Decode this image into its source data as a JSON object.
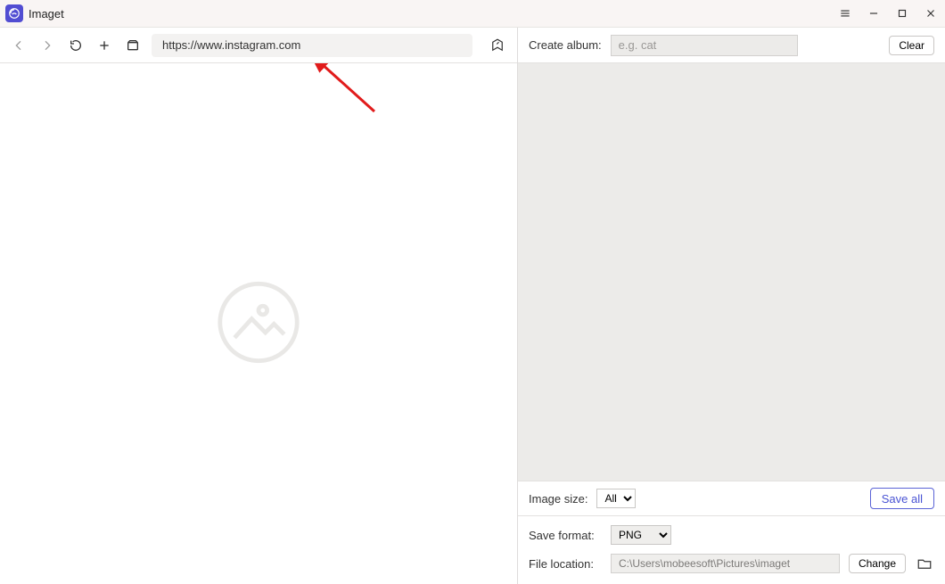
{
  "titlebar": {
    "app_name": "Imaget"
  },
  "left": {
    "url_value": "https://www.instagram.com"
  },
  "right": {
    "create_album_label": "Create album:",
    "create_album_placeholder": "e.g. cat",
    "clear_label": "Clear",
    "image_size_label": "Image size:",
    "image_size_value": "All",
    "save_all_label": "Save all",
    "save_format_label": "Save format:",
    "save_format_value": "PNG",
    "file_location_label": "File location:",
    "file_location_value": "C:\\Users\\mobeesoft\\Pictures\\imaget",
    "change_label": "Change"
  },
  "annotation": {
    "color": "#e11b1b"
  }
}
